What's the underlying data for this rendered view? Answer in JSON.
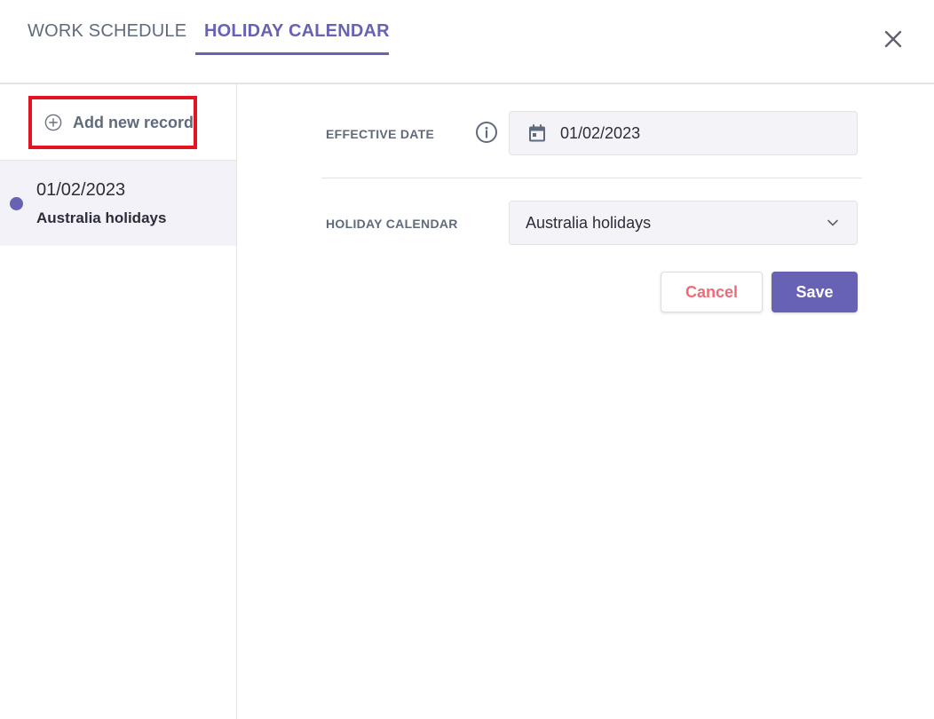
{
  "tabs": [
    {
      "label": "WORK SCHEDULE",
      "active": false
    },
    {
      "label": "HOLIDAY CALENDAR",
      "active": true
    }
  ],
  "icons": {
    "close": "close-icon",
    "add": "plus-circle-icon",
    "info": "info-icon",
    "calendar": "calendar-icon",
    "chevron": "chevron-down-icon"
  },
  "sidebar": {
    "add_label": "Add new record",
    "records": [
      {
        "date": "01/02/2023",
        "name": "Australia holidays",
        "selected": true
      }
    ]
  },
  "form": {
    "effective_date_label": "EFFECTIVE DATE",
    "effective_date_value": "01/02/2023",
    "holiday_calendar_label": "HOLIDAY CALENDAR",
    "holiday_calendar_value": "Australia holidays",
    "cancel_label": "Cancel",
    "save_label": "Save"
  },
  "colors": {
    "accent": "#6762b3",
    "cancel_text": "#f06b78",
    "highlight_border": "#e3141f",
    "muted_text": "#5f6b7d"
  }
}
